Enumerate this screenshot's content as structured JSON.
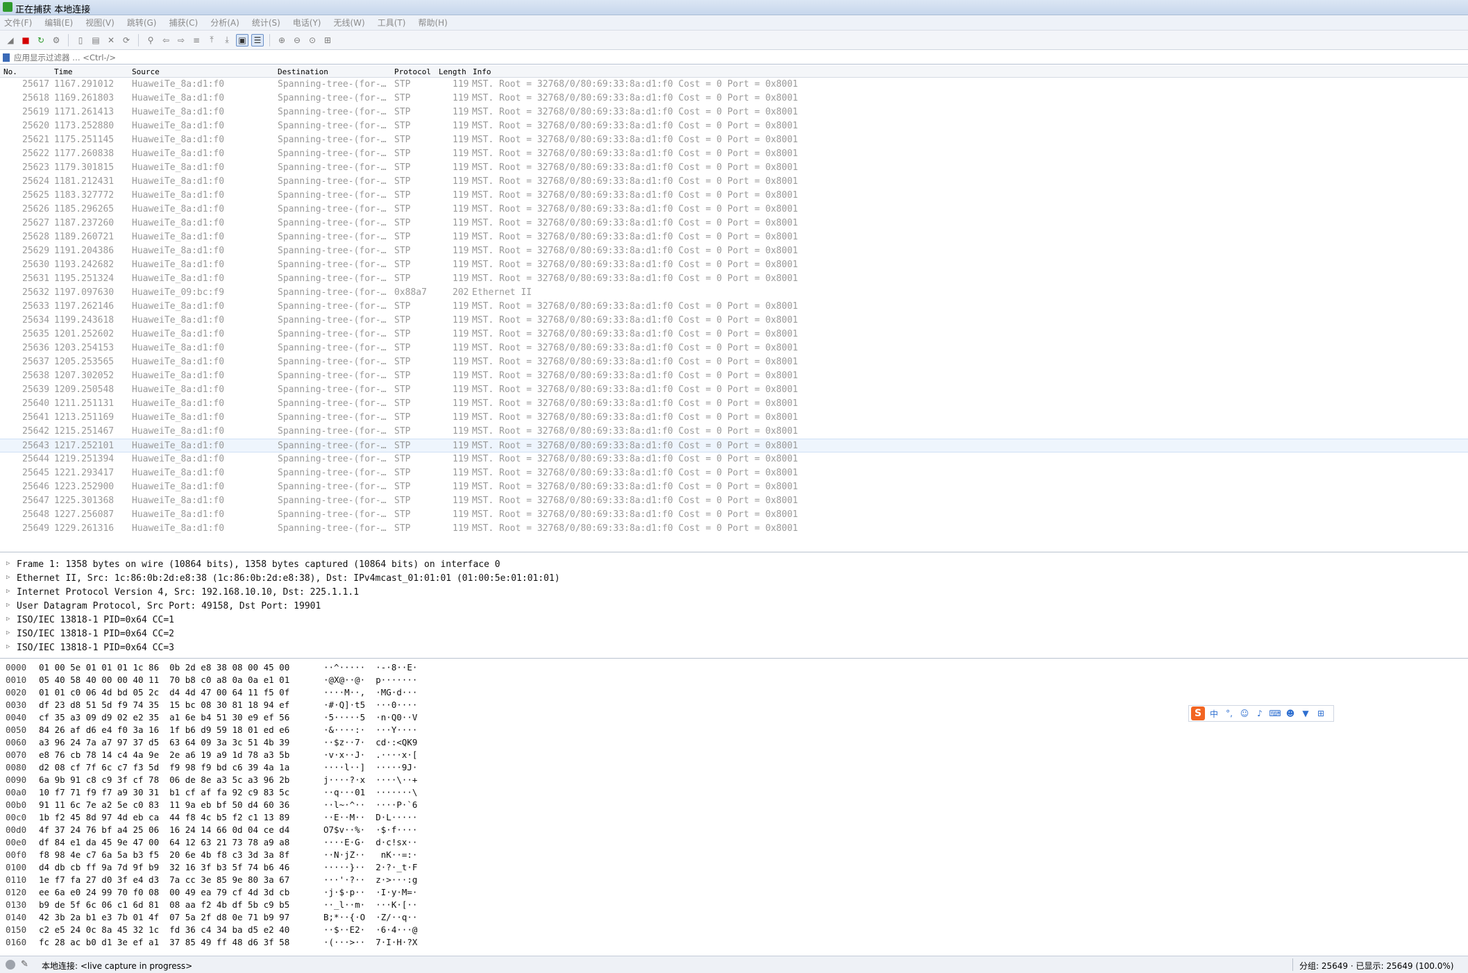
{
  "window": {
    "title": "正在捕获 本地连接"
  },
  "menu": [
    "文件(F)",
    "编辑(E)",
    "视图(V)",
    "跳转(G)",
    "捕获(C)",
    "分析(A)",
    "统计(S)",
    "电话(Y)",
    "无线(W)",
    "工具(T)",
    "帮助(H)"
  ],
  "filter": {
    "placeholder": "应用显示过滤器 … <Ctrl-/>"
  },
  "packet_list": {
    "columns": [
      "No.",
      "Time",
      "Source",
      "Destination",
      "Protocol",
      "Length",
      "Info"
    ],
    "rows": [
      {
        "no": "25617",
        "time": "1167.291012",
        "src": "HuaweiTe_8a:d1:f0",
        "dst": "Spanning-tree-(for-…",
        "proto": "STP",
        "len": "119",
        "info": "MST. Root = 32768/0/80:69:33:8a:d1:f0  Cost = 0  Port = 0x8001"
      },
      {
        "no": "25618",
        "time": "1169.261803",
        "src": "HuaweiTe_8a:d1:f0",
        "dst": "Spanning-tree-(for-…",
        "proto": "STP",
        "len": "119",
        "info": "MST. Root = 32768/0/80:69:33:8a:d1:f0  Cost = 0  Port = 0x8001"
      },
      {
        "no": "25619",
        "time": "1171.261413",
        "src": "HuaweiTe_8a:d1:f0",
        "dst": "Spanning-tree-(for-…",
        "proto": "STP",
        "len": "119",
        "info": "MST. Root = 32768/0/80:69:33:8a:d1:f0  Cost = 0  Port = 0x8001"
      },
      {
        "no": "25620",
        "time": "1173.252880",
        "src": "HuaweiTe_8a:d1:f0",
        "dst": "Spanning-tree-(for-…",
        "proto": "STP",
        "len": "119",
        "info": "MST. Root = 32768/0/80:69:33:8a:d1:f0  Cost = 0  Port = 0x8001"
      },
      {
        "no": "25621",
        "time": "1175.251145",
        "src": "HuaweiTe_8a:d1:f0",
        "dst": "Spanning-tree-(for-…",
        "proto": "STP",
        "len": "119",
        "info": "MST. Root = 32768/0/80:69:33:8a:d1:f0  Cost = 0  Port = 0x8001"
      },
      {
        "no": "25622",
        "time": "1177.260838",
        "src": "HuaweiTe_8a:d1:f0",
        "dst": "Spanning-tree-(for-…",
        "proto": "STP",
        "len": "119",
        "info": "MST. Root = 32768/0/80:69:33:8a:d1:f0  Cost = 0  Port = 0x8001"
      },
      {
        "no": "25623",
        "time": "1179.301815",
        "src": "HuaweiTe_8a:d1:f0",
        "dst": "Spanning-tree-(for-…",
        "proto": "STP",
        "len": "119",
        "info": "MST. Root = 32768/0/80:69:33:8a:d1:f0  Cost = 0  Port = 0x8001"
      },
      {
        "no": "25624",
        "time": "1181.212431",
        "src": "HuaweiTe_8a:d1:f0",
        "dst": "Spanning-tree-(for-…",
        "proto": "STP",
        "len": "119",
        "info": "MST. Root = 32768/0/80:69:33:8a:d1:f0  Cost = 0  Port = 0x8001"
      },
      {
        "no": "25625",
        "time": "1183.327772",
        "src": "HuaweiTe_8a:d1:f0",
        "dst": "Spanning-tree-(for-…",
        "proto": "STP",
        "len": "119",
        "info": "MST. Root = 32768/0/80:69:33:8a:d1:f0  Cost = 0  Port = 0x8001"
      },
      {
        "no": "25626",
        "time": "1185.296265",
        "src": "HuaweiTe_8a:d1:f0",
        "dst": "Spanning-tree-(for-…",
        "proto": "STP",
        "len": "119",
        "info": "MST. Root = 32768/0/80:69:33:8a:d1:f0  Cost = 0  Port = 0x8001"
      },
      {
        "no": "25627",
        "time": "1187.237260",
        "src": "HuaweiTe_8a:d1:f0",
        "dst": "Spanning-tree-(for-…",
        "proto": "STP",
        "len": "119",
        "info": "MST. Root = 32768/0/80:69:33:8a:d1:f0  Cost = 0  Port = 0x8001"
      },
      {
        "no": "25628",
        "time": "1189.260721",
        "src": "HuaweiTe_8a:d1:f0",
        "dst": "Spanning-tree-(for-…",
        "proto": "STP",
        "len": "119",
        "info": "MST. Root = 32768/0/80:69:33:8a:d1:f0  Cost = 0  Port = 0x8001"
      },
      {
        "no": "25629",
        "time": "1191.204386",
        "src": "HuaweiTe_8a:d1:f0",
        "dst": "Spanning-tree-(for-…",
        "proto": "STP",
        "len": "119",
        "info": "MST. Root = 32768/0/80:69:33:8a:d1:f0  Cost = 0  Port = 0x8001"
      },
      {
        "no": "25630",
        "time": "1193.242682",
        "src": "HuaweiTe_8a:d1:f0",
        "dst": "Spanning-tree-(for-…",
        "proto": "STP",
        "len": "119",
        "info": "MST. Root = 32768/0/80:69:33:8a:d1:f0  Cost = 0  Port = 0x8001"
      },
      {
        "no": "25631",
        "time": "1195.251324",
        "src": "HuaweiTe_8a:d1:f0",
        "dst": "Spanning-tree-(for-…",
        "proto": "STP",
        "len": "119",
        "info": "MST. Root = 32768/0/80:69:33:8a:d1:f0  Cost = 0  Port = 0x8001"
      },
      {
        "no": "25632",
        "time": "1197.097630",
        "src": "HuaweiTe_09:bc:f9",
        "dst": "Spanning-tree-(for-…",
        "proto": "0x88a7",
        "len": "202",
        "info": "Ethernet II"
      },
      {
        "no": "25633",
        "time": "1197.262146",
        "src": "HuaweiTe_8a:d1:f0",
        "dst": "Spanning-tree-(for-…",
        "proto": "STP",
        "len": "119",
        "info": "MST. Root = 32768/0/80:69:33:8a:d1:f0  Cost = 0  Port = 0x8001"
      },
      {
        "no": "25634",
        "time": "1199.243618",
        "src": "HuaweiTe_8a:d1:f0",
        "dst": "Spanning-tree-(for-…",
        "proto": "STP",
        "len": "119",
        "info": "MST. Root = 32768/0/80:69:33:8a:d1:f0  Cost = 0  Port = 0x8001"
      },
      {
        "no": "25635",
        "time": "1201.252602",
        "src": "HuaweiTe_8a:d1:f0",
        "dst": "Spanning-tree-(for-…",
        "proto": "STP",
        "len": "119",
        "info": "MST. Root = 32768/0/80:69:33:8a:d1:f0  Cost = 0  Port = 0x8001"
      },
      {
        "no": "25636",
        "time": "1203.254153",
        "src": "HuaweiTe_8a:d1:f0",
        "dst": "Spanning-tree-(for-…",
        "proto": "STP",
        "len": "119",
        "info": "MST. Root = 32768/0/80:69:33:8a:d1:f0  Cost = 0  Port = 0x8001"
      },
      {
        "no": "25637",
        "time": "1205.253565",
        "src": "HuaweiTe_8a:d1:f0",
        "dst": "Spanning-tree-(for-…",
        "proto": "STP",
        "len": "119",
        "info": "MST. Root = 32768/0/80:69:33:8a:d1:f0  Cost = 0  Port = 0x8001"
      },
      {
        "no": "25638",
        "time": "1207.302052",
        "src": "HuaweiTe_8a:d1:f0",
        "dst": "Spanning-tree-(for-…",
        "proto": "STP",
        "len": "119",
        "info": "MST. Root = 32768/0/80:69:33:8a:d1:f0  Cost = 0  Port = 0x8001"
      },
      {
        "no": "25639",
        "time": "1209.250548",
        "src": "HuaweiTe_8a:d1:f0",
        "dst": "Spanning-tree-(for-…",
        "proto": "STP",
        "len": "119",
        "info": "MST. Root = 32768/0/80:69:33:8a:d1:f0  Cost = 0  Port = 0x8001"
      },
      {
        "no": "25640",
        "time": "1211.251131",
        "src": "HuaweiTe_8a:d1:f0",
        "dst": "Spanning-tree-(for-…",
        "proto": "STP",
        "len": "119",
        "info": "MST. Root = 32768/0/80:69:33:8a:d1:f0  Cost = 0  Port = 0x8001"
      },
      {
        "no": "25641",
        "time": "1213.251169",
        "src": "HuaweiTe_8a:d1:f0",
        "dst": "Spanning-tree-(for-…",
        "proto": "STP",
        "len": "119",
        "info": "MST. Root = 32768/0/80:69:33:8a:d1:f0  Cost = 0  Port = 0x8001"
      },
      {
        "no": "25642",
        "time": "1215.251467",
        "src": "HuaweiTe_8a:d1:f0",
        "dst": "Spanning-tree-(for-…",
        "proto": "STP",
        "len": "119",
        "info": "MST. Root = 32768/0/80:69:33:8a:d1:f0  Cost = 0  Port = 0x8001"
      },
      {
        "no": "25643",
        "time": "1217.252101",
        "src": "HuaweiTe_8a:d1:f0",
        "dst": "Spanning-tree-(for-…",
        "proto": "STP",
        "len": "119",
        "info": "MST. Root = 32768/0/80:69:33:8a:d1:f0  Cost = 0  Port = 0x8001",
        "selected": true
      },
      {
        "no": "25644",
        "time": "1219.251394",
        "src": "HuaweiTe_8a:d1:f0",
        "dst": "Spanning-tree-(for-…",
        "proto": "STP",
        "len": "119",
        "info": "MST. Root = 32768/0/80:69:33:8a:d1:f0  Cost = 0  Port = 0x8001"
      },
      {
        "no": "25645",
        "time": "1221.293417",
        "src": "HuaweiTe_8a:d1:f0",
        "dst": "Spanning-tree-(for-…",
        "proto": "STP",
        "len": "119",
        "info": "MST. Root = 32768/0/80:69:33:8a:d1:f0  Cost = 0  Port = 0x8001"
      },
      {
        "no": "25646",
        "time": "1223.252900",
        "src": "HuaweiTe_8a:d1:f0",
        "dst": "Spanning-tree-(for-…",
        "proto": "STP",
        "len": "119",
        "info": "MST. Root = 32768/0/80:69:33:8a:d1:f0  Cost = 0  Port = 0x8001"
      },
      {
        "no": "25647",
        "time": "1225.301368",
        "src": "HuaweiTe_8a:d1:f0",
        "dst": "Spanning-tree-(for-…",
        "proto": "STP",
        "len": "119",
        "info": "MST. Root = 32768/0/80:69:33:8a:d1:f0  Cost = 0  Port = 0x8001"
      },
      {
        "no": "25648",
        "time": "1227.256087",
        "src": "HuaweiTe_8a:d1:f0",
        "dst": "Spanning-tree-(for-…",
        "proto": "STP",
        "len": "119",
        "info": "MST. Root = 32768/0/80:69:33:8a:d1:f0  Cost = 0  Port = 0x8001"
      },
      {
        "no": "25649",
        "time": "1229.261316",
        "src": "HuaweiTe_8a:d1:f0",
        "dst": "Spanning-tree-(for-…",
        "proto": "STP",
        "len": "119",
        "info": "MST. Root = 32768/0/80:69:33:8a:d1:f0  Cost = 0  Port = 0x8001"
      }
    ]
  },
  "details": [
    "Frame 1: 1358 bytes on wire (10864 bits), 1358 bytes captured (10864 bits) on interface 0",
    "Ethernet II, Src: 1c:86:0b:2d:e8:38 (1c:86:0b:2d:e8:38), Dst: IPv4mcast_01:01:01 (01:00:5e:01:01:01)",
    "Internet Protocol Version 4, Src: 192.168.10.10, Dst: 225.1.1.1",
    "User Datagram Protocol, Src Port: 49158, Dst Port: 19901",
    "ISO/IEC 13818-1 PID=0x64 CC=1",
    "ISO/IEC 13818-1 PID=0x64 CC=2",
    "ISO/IEC 13818-1 PID=0x64 CC=3"
  ],
  "bytes": [
    {
      "off": "0000",
      "hex": "01 00 5e 01 01 01 1c 86  0b 2d e8 38 08 00 45 00",
      "asc": "··^·····  ·-·8··E·"
    },
    {
      "off": "0010",
      "hex": "05 40 58 40 00 00 40 11  70 b8 c0 a8 0a 0a e1 01",
      "asc": "·@X@··@·  p·······"
    },
    {
      "off": "0020",
      "hex": "01 01 c0 06 4d bd 05 2c  d4 4d 47 00 64 11 f5 0f",
      "asc": "····M··,  ·MG·d···"
    },
    {
      "off": "0030",
      "hex": "df 23 d8 51 5d f9 74 35  15 bc 08 30 81 18 94 ef",
      "asc": "·#·Q]·t5  ···0····"
    },
    {
      "off": "0040",
      "hex": "cf 35 a3 09 d9 02 e2 35  a1 6e b4 51 30 e9 ef 56",
      "asc": "·5·····5  ·n·Q0··V"
    },
    {
      "off": "0050",
      "hex": "84 26 af d6 e4 f0 3a 16  1f b6 d9 59 18 01 ed e6",
      "asc": "·&····:·  ···Y····"
    },
    {
      "off": "0060",
      "hex": "a3 96 24 7a a7 97 37 d5  63 64 09 3a 3c 51 4b 39",
      "asc": "··$z··7·  cd·:<QK9"
    },
    {
      "off": "0070",
      "hex": "e8 76 cb 78 14 c4 4a 9e  2e a6 19 a9 1d 78 a3 5b",
      "asc": "·v·x··J·  .····x·["
    },
    {
      "off": "0080",
      "hex": "d2 08 cf 7f 6c c7 f3 5d  f9 98 f9 bd c6 39 4a 1a",
      "asc": "····l··]  ·····9J·"
    },
    {
      "off": "0090",
      "hex": "6a 9b 91 c8 c9 3f cf 78  06 de 8e a3 5c a3 96 2b",
      "asc": "j····?·x  ····\\··+"
    },
    {
      "off": "00a0",
      "hex": "10 f7 71 f9 f7 a9 30 31  b1 cf af fa 92 c9 83 5c",
      "asc": "··q···01  ·······\\"
    },
    {
      "off": "00b0",
      "hex": "91 11 6c 7e a2 5e c0 83  11 9a eb bf 50 d4 60 36",
      "asc": "··l~·^··  ····P·`6"
    },
    {
      "off": "00c0",
      "hex": "1b f2 45 8d 97 4d eb ca  44 f8 4c b5 f2 c1 13 89",
      "asc": "··E··M··  D·L·····"
    },
    {
      "off": "00d0",
      "hex": "4f 37 24 76 bf a4 25 06  16 24 14 66 0d 04 ce d4",
      "asc": "O7$v··%·  ·$·f····"
    },
    {
      "off": "00e0",
      "hex": "df 84 e1 da 45 9e 47 00  64 12 63 21 73 78 a9 a8",
      "asc": "····E·G·  d·c!sx··"
    },
    {
      "off": "00f0",
      "hex": "f8 98 4e c7 6a 5a b3 f5  20 6e 4b f8 c3 3d 3a 8f",
      "asc": "··N·jZ··   nK··=:·"
    },
    {
      "off": "0100",
      "hex": "d4 db cb ff 9a 7d 9f b9  32 16 3f b3 5f 74 b6 46",
      "asc": "·····}··  2·?·_t·F"
    },
    {
      "off": "0110",
      "hex": "1e f7 fa 27 d0 3f e4 d3  7a cc 3e 85 9e 80 3a 67",
      "asc": "···'·?··  z·>···:g"
    },
    {
      "off": "0120",
      "hex": "ee 6a e0 24 99 70 f0 08  00 49 ea 79 cf 4d 3d cb",
      "asc": "·j·$·p··  ·I·y·M=·"
    },
    {
      "off": "0130",
      "hex": "b9 de 5f 6c 06 c1 6d 81  08 aa f2 4b df 5b c9 b5",
      "asc": "··_l··m·  ···K·[··"
    },
    {
      "off": "0140",
      "hex": "42 3b 2a b1 e3 7b 01 4f  07 5a 2f d8 0e 71 b9 97",
      "asc": "B;*··{·O  ·Z/··q··"
    },
    {
      "off": "0150",
      "hex": "c2 e5 24 0c 8a 45 32 1c  fd 36 c4 34 ba d5 e2 40",
      "asc": "··$··E2·  ·6·4···@"
    },
    {
      "off": "0160",
      "hex": "fc 28 ac b0 d1 3e ef a1  37 85 49 ff 48 d6 3f 58",
      "asc": "·(···>··  7·I·H·?X"
    }
  ],
  "ime": {
    "logo": "S",
    "mode": "中"
  },
  "status": {
    "left": "本地连接: <live capture in progress>",
    "right": "分组: 25649 · 已显示: 25649 (100.0%)"
  }
}
